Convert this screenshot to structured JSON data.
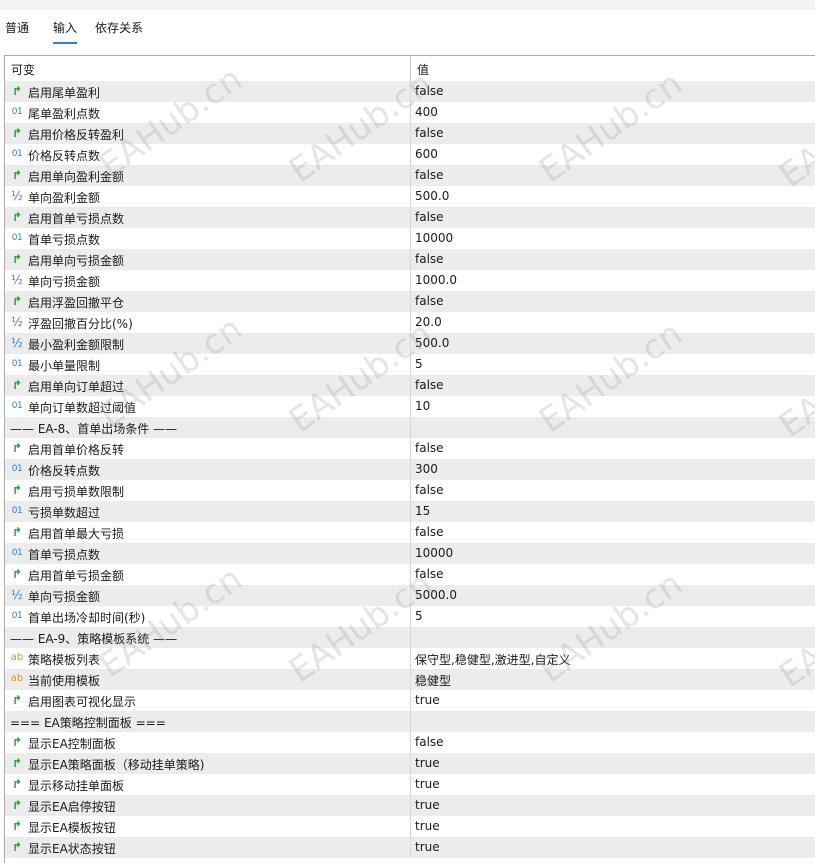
{
  "tabs": [
    "普通",
    "输入",
    "依存关系"
  ],
  "active_tab": 1,
  "table": {
    "header": {
      "name": "可变",
      "value": "值"
    },
    "rows": [
      {
        "type": "bool",
        "name": "启用尾单盈利",
        "value": "false"
      },
      {
        "type": "int",
        "name": "尾单盈利点数",
        "value": "400"
      },
      {
        "type": "bool",
        "name": "启用价格反转盈利",
        "value": "false"
      },
      {
        "type": "int",
        "name": "价格反转点数",
        "value": "600"
      },
      {
        "type": "bool",
        "name": "启用单向盈利金额",
        "value": "false"
      },
      {
        "type": "double",
        "name": "单向盈利金额",
        "value": "500.0"
      },
      {
        "type": "bool",
        "name": "启用首单亏损点数",
        "value": "false"
      },
      {
        "type": "int",
        "name": "首单亏损点数",
        "value": "10000"
      },
      {
        "type": "bool",
        "name": "启用单向亏损金额",
        "value": "false"
      },
      {
        "type": "double",
        "name": "单向亏损金额",
        "value": "1000.0"
      },
      {
        "type": "bool",
        "name": "启用浮盈回撤平仓",
        "value": "false"
      },
      {
        "type": "double",
        "name": "浮盈回撤百分比(%)",
        "value": "20.0"
      },
      {
        "type": "double",
        "name": "最小盈利金额限制",
        "value": "500.0"
      },
      {
        "type": "int",
        "name": "最小单量限制",
        "value": "5"
      },
      {
        "type": "bool",
        "name": "启用单向订单超过",
        "value": "false"
      },
      {
        "type": "int",
        "name": "单向订单数超过阈值",
        "value": "10"
      },
      {
        "type": "section",
        "name": "—— EA-8、首单出场条件 ——",
        "value": ""
      },
      {
        "type": "bool",
        "name": "启用首单价格反转",
        "value": "false"
      },
      {
        "type": "int",
        "name": "价格反转点数",
        "value": "300"
      },
      {
        "type": "bool",
        "name": "启用亏损单数限制",
        "value": "false"
      },
      {
        "type": "int",
        "name": "亏损单数超过",
        "value": "15"
      },
      {
        "type": "bool",
        "name": "启用首单最大亏损",
        "value": "false"
      },
      {
        "type": "int",
        "name": "首单亏损点数",
        "value": "10000"
      },
      {
        "type": "bool",
        "name": "启用首单亏损金额",
        "value": "false"
      },
      {
        "type": "double",
        "name": "单向亏损金额",
        "value": "5000.0"
      },
      {
        "type": "int",
        "name": "首单出场冷却时间(秒)",
        "value": "5"
      },
      {
        "type": "section",
        "name": "—— EA-9、策略模板系统 ——",
        "value": ""
      },
      {
        "type": "string",
        "name": "策略模板列表",
        "value": "保守型,稳健型,激进型,自定义"
      },
      {
        "type": "string",
        "name": "当前使用模板",
        "value": "稳健型"
      },
      {
        "type": "bool",
        "name": "启用图表可视化显示",
        "value": "true"
      },
      {
        "type": "section",
        "name": "=== EA策略控制面板 ===",
        "value": ""
      },
      {
        "type": "bool",
        "name": "显示EA控制面板",
        "value": "false"
      },
      {
        "type": "bool",
        "name": "显示EA策略面板（移动挂单策略)",
        "value": "true"
      },
      {
        "type": "bool",
        "name": "显示移动挂单面板",
        "value": "true"
      },
      {
        "type": "bool",
        "name": "显示EA启停按钮",
        "value": "true"
      },
      {
        "type": "bool",
        "name": "显示EA模板按钮",
        "value": "true"
      },
      {
        "type": "bool",
        "name": "显示EA状态按钮",
        "value": "true"
      }
    ]
  },
  "icons": {
    "bool": "flag-arrow-icon",
    "int": "integer-icon",
    "double": "fraction-icon",
    "string": "text-icon"
  },
  "icon_glyphs": {
    "bool": "↱",
    "int": "01",
    "double": "½",
    "string": "ab"
  },
  "colors": {
    "accent": "#2d7fd3",
    "row_shade": "#ececec",
    "bool_icon": "#2aa02a",
    "string_icon": "#d6902a"
  }
}
